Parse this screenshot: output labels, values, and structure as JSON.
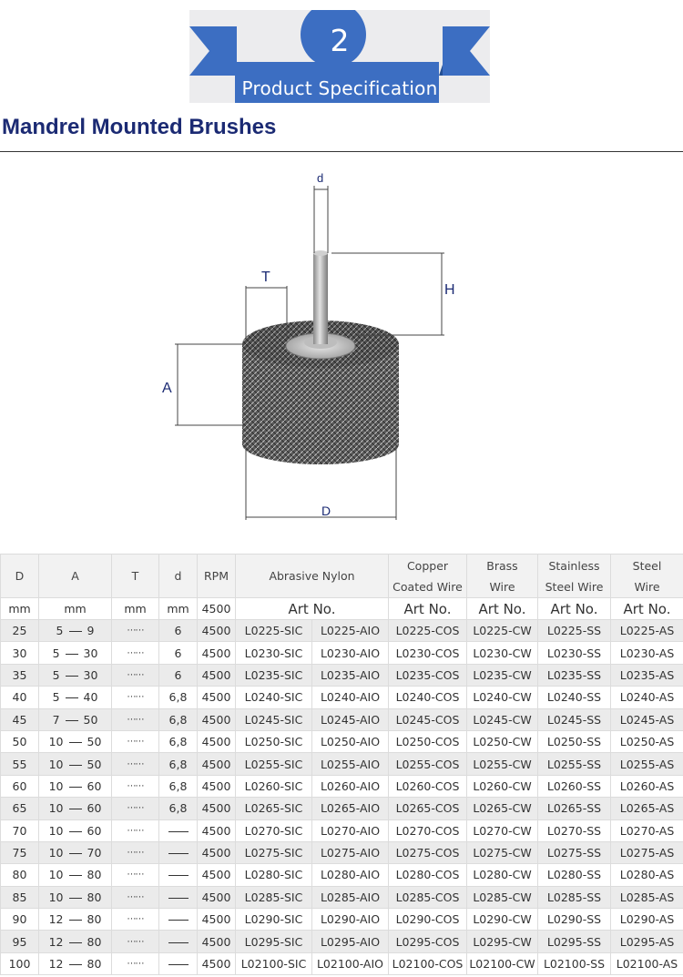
{
  "banner": {
    "number": "2",
    "title": "Product Specification",
    "color": "#3b6fc4"
  },
  "heading": "Mandrel Mounted Brushes",
  "drawing": {
    "labels": {
      "d": "d",
      "T": "T",
      "H": "H",
      "A": "A",
      "D": "D"
    }
  },
  "table": {
    "header": {
      "D": "D",
      "A": "A",
      "T": "T",
      "d": "d",
      "RPM": "RPM",
      "abrasive_nylon": "Abrasive Nylon",
      "copper_1": "Copper",
      "copper_2": "Coated Wire",
      "brass_1": "Brass",
      "brass_2": "Wire",
      "stainless_1": "Stainless",
      "stainless_2": "Steel Wire",
      "steel_1": "Steel",
      "steel_2": "Wire"
    },
    "units": {
      "D": "mm",
      "A": "mm",
      "T": "mm",
      "d": "mm",
      "RPM": "4500",
      "art": "Art No."
    },
    "rows": [
      {
        "D": "25",
        "A1": "5",
        "A2": "9",
        "T": "⋯⋯",
        "d": "6",
        "rpm": "4500",
        "sic": "L0225-SIC",
        "aio": "L0225-AIO",
        "cos": "L0225-COS",
        "cw": "L0225-CW",
        "ss": "L0225-SS",
        "as": "L0225-AS"
      },
      {
        "D": "30",
        "A1": "5",
        "A2": "30",
        "T": "⋯⋯",
        "d": "6",
        "rpm": "4500",
        "sic": "L0230-SIC",
        "aio": "L0230-AIO",
        "cos": "L0230-COS",
        "cw": "L0230-CW",
        "ss": "L0230-SS",
        "as": "L0230-AS"
      },
      {
        "D": "35",
        "A1": "5",
        "A2": "30",
        "T": "⋯⋯",
        "d": "6",
        "rpm": "4500",
        "sic": "L0235-SIC",
        "aio": "L0235-AIO",
        "cos": "L0235-COS",
        "cw": "L0235-CW",
        "ss": "L0235-SS",
        "as": "L0235-AS"
      },
      {
        "D": "40",
        "A1": "5",
        "A2": "40",
        "T": "⋯⋯",
        "d": "6,8",
        "rpm": "4500",
        "sic": "L0240-SIC",
        "aio": "L0240-AIO",
        "cos": "L0240-COS",
        "cw": "L0240-CW",
        "ss": "L0240-SS",
        "as": "L0240-AS"
      },
      {
        "D": "45",
        "A1": "7",
        "A2": "50",
        "T": "⋯⋯",
        "d": "6,8",
        "rpm": "4500",
        "sic": "L0245-SIC",
        "aio": "L0245-AIO",
        "cos": "L0245-COS",
        "cw": "L0245-CW",
        "ss": "L0245-SS",
        "as": "L0245-AS"
      },
      {
        "D": "50",
        "A1": "10",
        "A2": "50",
        "T": "⋯⋯",
        "d": "6,8",
        "rpm": "4500",
        "sic": "L0250-SIC",
        "aio": "L0250-AIO",
        "cos": "L0250-COS",
        "cw": "L0250-CW",
        "ss": "L0250-SS",
        "as": "L0250-AS"
      },
      {
        "D": "55",
        "A1": "10",
        "A2": "50",
        "T": "⋯⋯",
        "d": "6,8",
        "rpm": "4500",
        "sic": "L0255-SIC",
        "aio": "L0255-AIO",
        "cos": "L0255-COS",
        "cw": "L0255-CW",
        "ss": "L0255-SS",
        "as": "L0255-AS"
      },
      {
        "D": "60",
        "A1": "10",
        "A2": "60",
        "T": "⋯⋯",
        "d": "6,8",
        "rpm": "4500",
        "sic": "L0260-SIC",
        "aio": "L0260-AIO",
        "cos": "L0260-COS",
        "cw": "L0260-CW",
        "ss": "L0260-SS",
        "as": "L0260-AS"
      },
      {
        "D": "65",
        "A1": "10",
        "A2": "60",
        "T": "⋯⋯",
        "d": "6,8",
        "rpm": "4500",
        "sic": "L0265-SIC",
        "aio": "L0265-AIO",
        "cos": "L0265-COS",
        "cw": "L0265-CW",
        "ss": "L0265-SS",
        "as": "L0265-AS"
      },
      {
        "D": "70",
        "A1": "10",
        "A2": "60",
        "T": "⋯⋯",
        "d": "",
        "rpm": "4500",
        "sic": "L0270-SIC",
        "aio": "L0270-AIO",
        "cos": "L0270-COS",
        "cw": "L0270-CW",
        "ss": "L0270-SS",
        "as": "L0270-AS"
      },
      {
        "D": "75",
        "A1": "10",
        "A2": "70",
        "T": "⋯⋯",
        "d": "",
        "rpm": "4500",
        "sic": "L0275-SIC",
        "aio": "L0275-AIO",
        "cos": "L0275-COS",
        "cw": "L0275-CW",
        "ss": "L0275-SS",
        "as": "L0275-AS"
      },
      {
        "D": "80",
        "A1": "10",
        "A2": "80",
        "T": "⋯⋯",
        "d": "",
        "rpm": "4500",
        "sic": "L0280-SIC",
        "aio": "L0280-AIO",
        "cos": "L0280-COS",
        "cw": "L0280-CW",
        "ss": "L0280-SS",
        "as": "L0280-AS"
      },
      {
        "D": "85",
        "A1": "10",
        "A2": "80",
        "T": "⋯⋯",
        "d": "",
        "rpm": "4500",
        "sic": "L0285-SIC",
        "aio": "L0285-AIO",
        "cos": "L0285-COS",
        "cw": "L0285-CW",
        "ss": "L0285-SS",
        "as": "L0285-AS"
      },
      {
        "D": "90",
        "A1": "12",
        "A2": "80",
        "T": "⋯⋯",
        "d": "",
        "rpm": "4500",
        "sic": "L0290-SIC",
        "aio": "L0290-AIO",
        "cos": "L0290-COS",
        "cw": "L0290-CW",
        "ss": "L0290-SS",
        "as": "L0290-AS"
      },
      {
        "D": "95",
        "A1": "12",
        "A2": "80",
        "T": "⋯⋯",
        "d": "",
        "rpm": "4500",
        "sic": "L0295-SIC",
        "aio": "L0295-AIO",
        "cos": "L0295-COS",
        "cw": "L0295-CW",
        "ss": "L0295-SS",
        "as": "L0295-AS"
      },
      {
        "D": "100",
        "A1": "12",
        "A2": "80",
        "T": "⋯⋯",
        "d": "",
        "rpm": "4500",
        "sic": "L02100-SIC",
        "aio": "L02100-AIO",
        "cos": "L02100-COS",
        "cw": "L02100-CW",
        "ss": "L02100-SS",
        "as": "L02100-AS"
      }
    ]
  }
}
